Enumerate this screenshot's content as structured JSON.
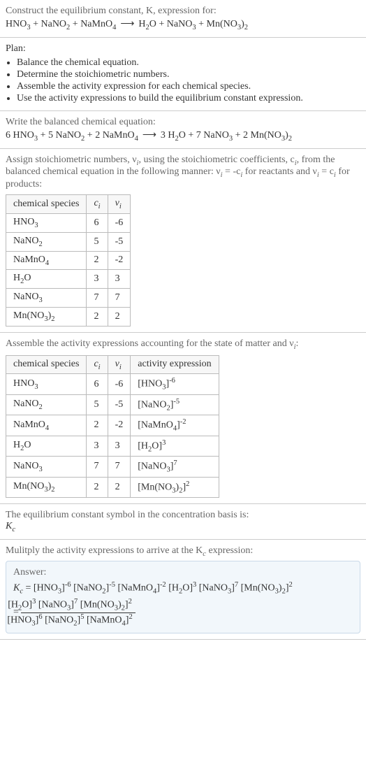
{
  "intro": {
    "prompt": "Construct the equilibrium constant, K, expression for:",
    "equation_lhs": [
      "HNO3",
      "NaNO2",
      "NaMnO4"
    ],
    "equation_rhs": [
      "H2O",
      "NaNO3",
      "Mn(NO3)2"
    ]
  },
  "plan": {
    "heading": "Plan:",
    "items": [
      "Balance the chemical equation.",
      "Determine the stoichiometric numbers.",
      "Assemble the activity expression for each chemical species.",
      "Use the activity expressions to build the equilibrium constant expression."
    ]
  },
  "balanced": {
    "heading": "Write the balanced chemical equation:",
    "lhs": [
      {
        "coef": "6",
        "f": "HNO3"
      },
      {
        "coef": "5",
        "f": "NaNO2"
      },
      {
        "coef": "2",
        "f": "NaMnO4"
      }
    ],
    "rhs": [
      {
        "coef": "3",
        "f": "H2O"
      },
      {
        "coef": "7",
        "f": "NaNO3"
      },
      {
        "coef": "2",
        "f": "Mn(NO3)2"
      }
    ]
  },
  "stoich": {
    "heading_a": "Assign stoichiometric numbers, ν",
    "heading_b": ", using the stoichiometric coefficients, c",
    "heading_c": ", from the balanced chemical equation in the following manner: ν",
    "heading_d": " = -c",
    "heading_e": " for reactants and ν",
    "heading_f": " = c",
    "heading_g": " for products:",
    "col_species": "chemical species",
    "col_c": "c",
    "col_nu": "ν",
    "rows": [
      {
        "sp": "HNO3",
        "c": "6",
        "nu": "-6"
      },
      {
        "sp": "NaNO2",
        "c": "5",
        "nu": "-5"
      },
      {
        "sp": "NaMnO4",
        "c": "2",
        "nu": "-2"
      },
      {
        "sp": "H2O",
        "c": "3",
        "nu": "3"
      },
      {
        "sp": "NaNO3",
        "c": "7",
        "nu": "7"
      },
      {
        "sp": "Mn(NO3)2",
        "c": "2",
        "nu": "2"
      }
    ]
  },
  "activity": {
    "heading": "Assemble the activity expressions accounting for the state of matter and ν",
    "heading_suffix": ":",
    "col_species": "chemical species",
    "col_c": "c",
    "col_nu": "ν",
    "col_act": "activity expression",
    "rows": [
      {
        "sp": "HNO3",
        "c": "6",
        "nu": "-6",
        "base": "HNO3",
        "exp": "-6"
      },
      {
        "sp": "NaNO2",
        "c": "5",
        "nu": "-5",
        "base": "NaNO2",
        "exp": "-5"
      },
      {
        "sp": "NaMnO4",
        "c": "2",
        "nu": "-2",
        "base": "NaMnO4",
        "exp": "-2"
      },
      {
        "sp": "H2O",
        "c": "3",
        "nu": "3",
        "base": "H2O",
        "exp": "3"
      },
      {
        "sp": "NaNO3",
        "c": "7",
        "nu": "7",
        "base": "NaNO3",
        "exp": "7"
      },
      {
        "sp": "Mn(NO3)2",
        "c": "2",
        "nu": "2",
        "base": "Mn(NO3)2",
        "exp": "2"
      }
    ]
  },
  "symbol": {
    "line1": "The equilibrium constant symbol in the concentration basis is:",
    "kc": "K",
    "kc_sub": "c"
  },
  "final": {
    "heading": "Mulitply the activity expressions to arrive at the K",
    "heading_sub": "c",
    "heading_suffix": " expression:",
    "answer_label": "Answer:",
    "eq_prefix": "K",
    "eq_prefix_sub": "c",
    "product_terms": [
      {
        "base": "HNO3",
        "exp": "-6"
      },
      {
        "base": "NaNO2",
        "exp": "-5"
      },
      {
        "base": "NaMnO4",
        "exp": "-2"
      },
      {
        "base": "H2O",
        "exp": "3"
      },
      {
        "base": "NaNO3",
        "exp": "7"
      },
      {
        "base": "Mn(NO3)2",
        "exp": "2"
      }
    ],
    "numerator": [
      {
        "base": "H2O",
        "exp": "3"
      },
      {
        "base": "NaNO3",
        "exp": "7"
      },
      {
        "base": "Mn(NO3)2",
        "exp": "2"
      }
    ],
    "denominator": [
      {
        "base": "HNO3",
        "exp": "6"
      },
      {
        "base": "NaNO2",
        "exp": "5"
      },
      {
        "base": "NaMnO4",
        "exp": "2"
      }
    ]
  },
  "chart_data": {
    "type": "table",
    "tables": [
      {
        "title": "Stoichiometric numbers",
        "columns": [
          "chemical species",
          "c_i",
          "ν_i"
        ],
        "rows": [
          [
            "HNO3",
            6,
            -6
          ],
          [
            "NaNO2",
            5,
            -5
          ],
          [
            "NaMnO4",
            2,
            -2
          ],
          [
            "H2O",
            3,
            3
          ],
          [
            "NaNO3",
            7,
            7
          ],
          [
            "Mn(NO3)2",
            2,
            2
          ]
        ]
      },
      {
        "title": "Activity expressions",
        "columns": [
          "chemical species",
          "c_i",
          "ν_i",
          "activity expression"
        ],
        "rows": [
          [
            "HNO3",
            6,
            -6,
            "[HNO3]^-6"
          ],
          [
            "NaNO2",
            5,
            -5,
            "[NaNO2]^-5"
          ],
          [
            "NaMnO4",
            2,
            -2,
            "[NaMnO4]^-2"
          ],
          [
            "H2O",
            3,
            3,
            "[H2O]^3"
          ],
          [
            "NaNO3",
            7,
            7,
            "[NaNO3]^7"
          ],
          [
            "Mn(NO3)2",
            2,
            2,
            "[Mn(NO3)2]^2"
          ]
        ]
      }
    ]
  }
}
